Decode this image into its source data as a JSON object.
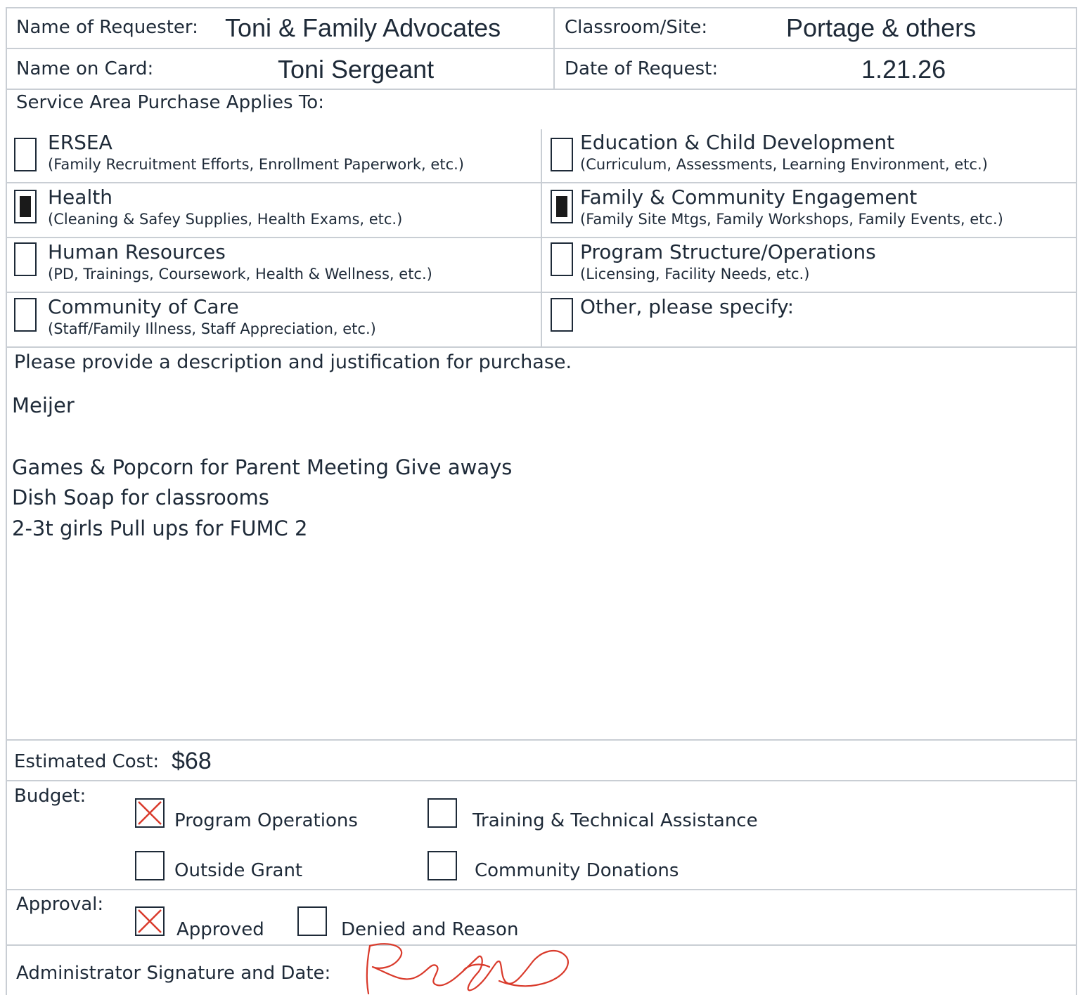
{
  "header": {
    "requester_label": "Name of Requester:",
    "requester_value": "Toni & Family Advocates",
    "site_label": "Classroom/Site:",
    "site_value": "Portage & others",
    "card_label": "Name on Card:",
    "card_value": "Toni Sergeant",
    "date_label": "Date of Request:",
    "date_value": "1.21.26"
  },
  "service_area": {
    "heading": "Service Area Purchase Applies To:",
    "items": [
      {
        "title": "ERSEA",
        "sub": "(Family Recruitment Efforts, Enrollment Paperwork, etc.)",
        "checked": false
      },
      {
        "title": "Education & Child Development",
        "sub": "(Curriculum, Assessments, Learning Environment, etc.)",
        "checked": false
      },
      {
        "title": "Health",
        "sub": "(Cleaning & Safey Supplies, Health Exams, etc.)",
        "checked": true
      },
      {
        "title": "Family & Community Engagement",
        "sub": "(Family Site Mtgs, Family Workshops, Family Events, etc.)",
        "checked": true
      },
      {
        "title": "Human Resources",
        "sub": "(PD, Trainings, Coursework, Health & Wellness, etc.)",
        "checked": false
      },
      {
        "title": "Program Structure/Operations",
        "sub": "(Licensing, Facility Needs, etc.)",
        "checked": false
      },
      {
        "title": "Community of Care",
        "sub": "(Staff/Family Illness, Staff Appreciation, etc.)",
        "checked": false
      },
      {
        "title": "Other, please specify:",
        "sub": "",
        "checked": false
      }
    ]
  },
  "description": {
    "prompt": "Please provide a description and justification for purchase.",
    "store": "Meijer",
    "lines": [
      "Games & Popcorn for Parent Meeting Give aways",
      "Dish Soap for classrooms",
      "2-3t girls Pull ups for FUMC 2"
    ]
  },
  "cost": {
    "label": "Estimated Cost:",
    "value": "$68"
  },
  "budget": {
    "label": "Budget:",
    "options": [
      {
        "label": "Program Operations",
        "checked": true
      },
      {
        "label": "Training & Technical Assistance",
        "checked": false
      },
      {
        "label": "Outside Grant",
        "checked": false
      },
      {
        "label": "Community Donations",
        "checked": false
      }
    ]
  },
  "approval": {
    "label": "Approval:",
    "options": [
      {
        "label": "Approved",
        "checked": true
      },
      {
        "label": "Denied and Reason",
        "checked": false
      }
    ]
  },
  "signature": {
    "label": "Administrator Signature and Date:"
  },
  "colors": {
    "ink": "#1e2a38",
    "grid": "#c9ced4",
    "mark": "#d93a2b"
  }
}
